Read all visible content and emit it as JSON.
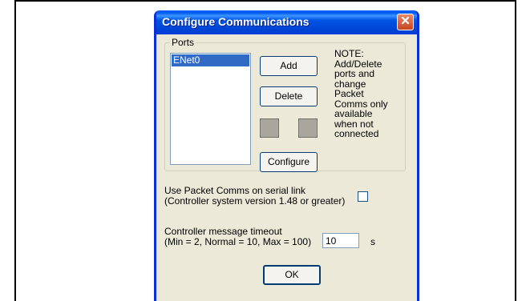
{
  "window": {
    "title": "Configure Communications",
    "close_glyph": "✕"
  },
  "ports": {
    "group_label": "Ports",
    "items": [
      "ENet0"
    ],
    "add_label": "Add",
    "delete_label": "Delete",
    "configure_label": "Configure"
  },
  "note": {
    "lines": [
      "NOTE:",
      "Add/Delete",
      "ports and",
      "change",
      "Packet",
      "Comms only",
      "available",
      "when not",
      "connected"
    ]
  },
  "packet_comms": {
    "line1": "Use Packet Comms on serial link",
    "line2": "(Controller system version 1.48 or greater)",
    "checked": false
  },
  "timeout": {
    "line1": "Controller message timeout",
    "line2": "(Min = 2, Normal = 10, Max = 100)",
    "value": "10",
    "unit": "s"
  },
  "ok_label": "OK",
  "colors": {
    "title_bar": "#0055e5",
    "dialog_bg": "#ece9d8",
    "selection": "#316ac5"
  }
}
